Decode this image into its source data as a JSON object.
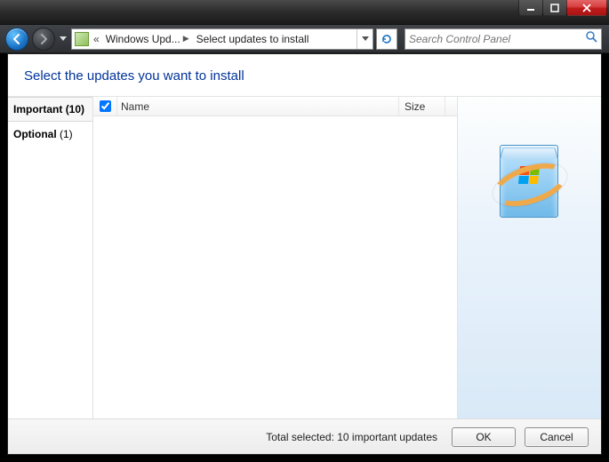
{
  "breadcrumb": {
    "chevrons": "«",
    "seg1": "Windows Upd...",
    "seg2": "Select updates to install"
  },
  "search": {
    "placeholder": "Search Control Panel"
  },
  "page_title": "Select the updates you want to install",
  "columns": {
    "name": "Name",
    "size": "Size"
  },
  "categories": [
    {
      "label": "Important",
      "count": "(10)",
      "active": true
    },
    {
      "label": "Optional",
      "count": "(1)",
      "active": false
    }
  ],
  "footer": {
    "status": "Total selected: 10 important updates",
    "ok": "OK",
    "cancel": "Cancel"
  }
}
